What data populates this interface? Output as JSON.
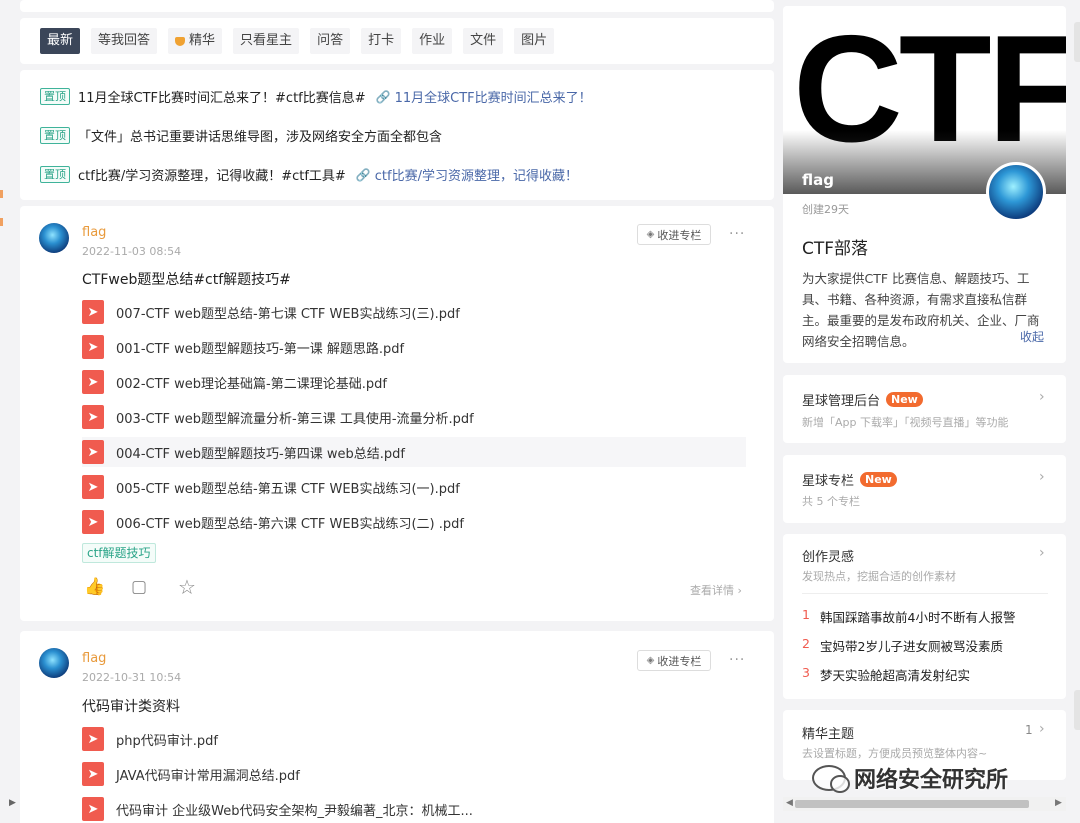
{
  "filters": {
    "tabs": [
      {
        "label": "最新",
        "active": true
      },
      {
        "label": "等我回答"
      },
      {
        "label": "精华",
        "icon": "gem-icon"
      },
      {
        "label": "只看星主"
      },
      {
        "label": "问答"
      },
      {
        "label": "打卡"
      },
      {
        "label": "作业"
      },
      {
        "label": "文件"
      },
      {
        "label": "图片"
      }
    ]
  },
  "pinned": {
    "badge": "置顶",
    "items": [
      {
        "text": "11月全球CTF比赛时间汇总来了！#ctf比赛信息#",
        "link": "11月全球CTF比赛时间汇总来了！"
      },
      {
        "text": "「文件」总书记重要讲话思维导图，涉及网络安全方面全都包含",
        "link": ""
      },
      {
        "text": "ctf比赛/学习资源整理，记得收藏！#ctf工具#",
        "link": "ctf比赛/学习资源整理，记得收藏！"
      }
    ]
  },
  "posts": [
    {
      "author": "flag",
      "time": "2022-11-03 08:54",
      "collect_label": "收进专栏",
      "more": "···",
      "title": "CTFweb题型总结#ctf解题技巧#",
      "files": [
        "007-CTF web题型总结-第七课 CTF WEB实战练习(三).pdf",
        "001-CTF web题型解题技巧-第一课 解题思路.pdf",
        "002-CTF web理论基础篇-第二课理论基础.pdf",
        "003-CTF web题型解流量分析-第三课 工具使用-流量分析.pdf",
        "004-CTF web题型解题技巧-第四课 web总结.pdf",
        "005-CTF web题型总结-第五课 CTF WEB实战练习(一).pdf",
        "006-CTF web题型总结-第六课 CTF WEB实战练习(二) .pdf"
      ],
      "tag": "ctf解题技巧",
      "see_detail": "查看详情 ›"
    },
    {
      "author": "flag",
      "time": "2022-10-31 10:54",
      "collect_label": "收进专栏",
      "more": "···",
      "title": "代码审计类资料",
      "files": [
        "php代码审计.pdf",
        "JAVA代码审计常用漏洞总结.pdf",
        "代码审计 企业级Web代码安全架构_尹毅编著_北京：机械工..."
      ]
    }
  ],
  "group": {
    "cover_text": "CTF",
    "cover_name": "flag",
    "created": "创建29天",
    "title": "CTF部落",
    "description": "为大家提供CTF 比赛信息、解题技巧、工具、书籍、各种资源，有需求直接私信群主。最重要的是发布政府机关、企业、厂商网络安全招聘信息。",
    "collapse": "收起"
  },
  "admin": {
    "title": "星球管理后台",
    "badge": "New",
    "sub": "新增「App 下载率」「视频号直播」等功能"
  },
  "columns": {
    "title": "星球专栏",
    "badge": "New",
    "sub": "共 5 个专栏"
  },
  "inspiration": {
    "title": "创作灵感",
    "sub": "发现热点，挖掘合适的创作素材",
    "items": [
      {
        "num": "1",
        "text": "韩国踩踏事故前4小时不断有人报警"
      },
      {
        "num": "2",
        "text": "宝妈带2岁儿子进女厕被骂没素质"
      },
      {
        "num": "3",
        "text": "梦天实验舱超高清发射纪实"
      }
    ]
  },
  "essence": {
    "title": "精华主题",
    "count": "1",
    "sub": "去设置标题，方便成员预览整体内容~"
  },
  "watermark": "网络安全研究所",
  "icons": {
    "chevron": "›",
    "link": "🔗",
    "like": "👍",
    "comment": "▢",
    "star": "☆"
  },
  "colors": {
    "accent": "#3b4659",
    "orange": "#e89a3c",
    "pdf": "#f05b4f",
    "link": "#4a68a8",
    "new": "#f26b2f"
  }
}
